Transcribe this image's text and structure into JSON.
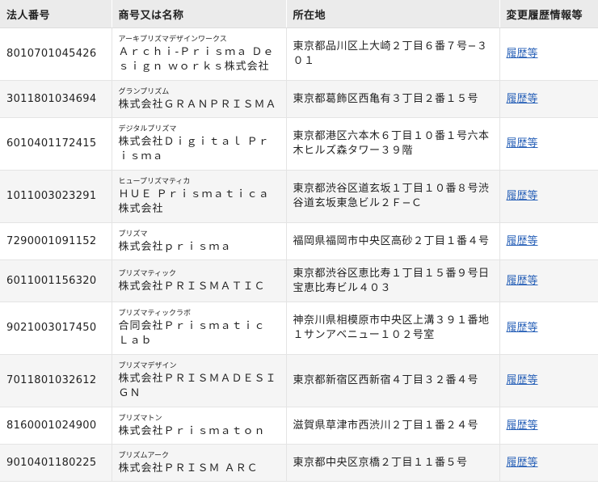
{
  "headers": {
    "corp_no": "法人番号",
    "name": "商号又は名称",
    "address": "所在地",
    "history": "変更履歴情報等"
  },
  "rows": [
    {
      "corp_no": "8010701045426",
      "kana": "アーキプリズマデザインワークス",
      "name": "Ａｒｃｈｉ-Ｐｒｉｓｍａ Ｄｅｓｉｇｎ ｗｏｒｋｓ株式会社",
      "address": "東京都品川区上大崎２丁目６番７号−３０１",
      "history": "履歴等"
    },
    {
      "corp_no": "3011801034694",
      "kana": "グランプリズム",
      "name": "株式会社ＧＲＡＮＰＲＩＳＭＡ",
      "address": "東京都葛飾区西亀有３丁目２番１５号",
      "history": "履歴等"
    },
    {
      "corp_no": "6010401172415",
      "kana": "デジタルプリズマ",
      "name": "株式会社Ｄｉｇｉｔａｌ Ｐｒｉｓｍａ",
      "address": "東京都港区六本木６丁目１０番１号六本木ヒルズ森タワー３９階",
      "history": "履歴等"
    },
    {
      "corp_no": "1011003023291",
      "kana": "ヒュープリズマティカ",
      "name": "ＨＵＥ Ｐｒｉｓｍａｔｉｃａ株式会社",
      "address": "東京都渋谷区道玄坂１丁目１０番８号渋谷道玄坂東急ビル２Ｆ−Ｃ",
      "history": "履歴等"
    },
    {
      "corp_no": "7290001091152",
      "kana": "プリズマ",
      "name": "株式会社ｐｒｉｓｍａ",
      "address": "福岡県福岡市中央区高砂２丁目１番４号",
      "history": "履歴等"
    },
    {
      "corp_no": "6011001156320",
      "kana": "プリズマティック",
      "name": "株式会社ＰＲＩＳＭＡＴＩＣ",
      "address": "東京都渋谷区恵比寿１丁目１５番９号日宝恵比寿ビル４０３",
      "history": "履歴等"
    },
    {
      "corp_no": "9021003017450",
      "kana": "プリズマティックラボ",
      "name": "合同会社Ｐｒｉｓｍａｔｉｃ Ｌａｂ",
      "address": "神奈川県相模原市中央区上溝３９１番地１サンアベニュー１０２号室",
      "history": "履歴等"
    },
    {
      "corp_no": "7011801032612",
      "kana": "プリズマデザイン",
      "name": "株式会社ＰＲＩＳＭＡＤＥＳＩＧＮ",
      "address": "東京都新宿区西新宿４丁目３２番４号",
      "history": "履歴等"
    },
    {
      "corp_no": "8160001024900",
      "kana": "プリズマトン",
      "name": "株式会社Ｐｒｉｓｍａｔｏｎ",
      "address": "滋賀県草津市西渋川２丁目１番２４号",
      "history": "履歴等"
    },
    {
      "corp_no": "9010401180225",
      "kana": "プリズムアーク",
      "name": "株式会社ＰＲＩＳＭ ＡＲＣ",
      "address": "東京都中央区京橋２丁目１１番５号",
      "history": "履歴等"
    }
  ]
}
